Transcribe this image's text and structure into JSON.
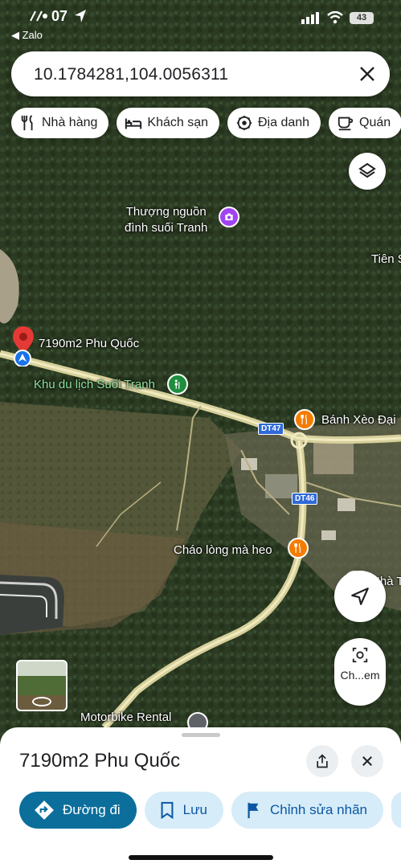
{
  "status_bar": {
    "time": "07",
    "back_app": "◀ Zalo",
    "battery": "43"
  },
  "search": {
    "query": "10.1784281,104.0056311",
    "clear_icon": "close-icon"
  },
  "categories": [
    {
      "label": "Nhà hàng",
      "icon": "restaurant-icon"
    },
    {
      "label": "Khách sạn",
      "icon": "hotel-icon"
    },
    {
      "label": "Địa danh",
      "icon": "landmark-icon"
    },
    {
      "label": "Quán",
      "icon": "coffee-icon"
    }
  ],
  "map": {
    "labels": {
      "poi_upstream": "Thượng nguồn\nđình suối Tranh",
      "tien": "Tiên S",
      "pin_name": "7190m2 Phu Quốc",
      "resort": "Khu du lịch Suối Tranh",
      "banh_xeo": "Bánh Xèo Đại",
      "chao_long": "Cháo lòng mà heo",
      "nha": "Nhà T",
      "motorbike": "Motorbike Rental"
    },
    "roads": {
      "dt47": "DT47",
      "dt46": "DT46"
    },
    "camera_label": "Ch...em"
  },
  "place": {
    "title": "7190m2 Phu Quốc"
  },
  "actions": [
    {
      "label": "Đường đi",
      "icon": "directions-icon"
    },
    {
      "label": "Lưu",
      "icon": "bookmark-icon"
    },
    {
      "label": "Chỉnh sửa nhãn",
      "icon": "flag-icon"
    }
  ],
  "colors": {
    "primary_action": "#0b6e9b",
    "secondary_action": "#d6ecf8",
    "pin_red": "#e53935",
    "poi_orange": "#f57c00",
    "poi_purple": "#a142f4",
    "poi_green": "#1e8e3e"
  }
}
